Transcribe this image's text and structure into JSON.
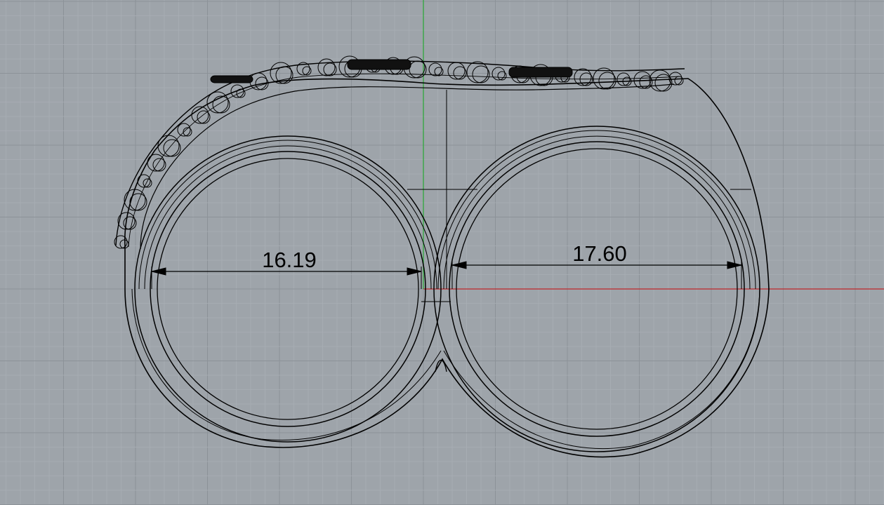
{
  "viewport": {
    "background_color": "#9ea4aa",
    "grid_minor_color": "#a8aeb4",
    "grid_major_color": "#8c9298",
    "x_axis_color": "#c0262a",
    "y_axis_color": "#2fa83c",
    "curve_color": "#000000"
  },
  "dimensions": [
    {
      "label": "16.19"
    },
    {
      "label": "17.60"
    }
  ]
}
